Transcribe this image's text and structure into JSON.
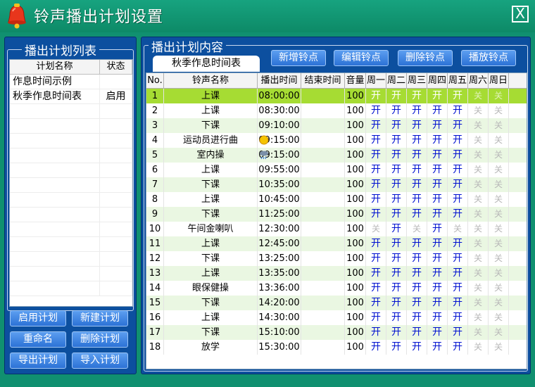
{
  "window": {
    "title": "铃声播出计划设置",
    "close_label": "X"
  },
  "left": {
    "title": "播出计划列表",
    "columns": [
      "计划名称",
      "状态"
    ],
    "plans": [
      {
        "name": "作息时间示例",
        "state": ""
      },
      {
        "name": "秋季作息时间表",
        "state": "启用"
      }
    ],
    "buttons": [
      "启用计划",
      "新建计划",
      "重命名",
      "删除计划",
      "导出计划",
      "导入计划"
    ]
  },
  "right": {
    "title": "播出计划内容",
    "tab": "秋季作息时间表",
    "buttons": [
      "新增铃点",
      "编辑铃点",
      "删除铃点",
      "播放铃点"
    ],
    "columns": [
      "No.",
      "铃声名称",
      "播出时间",
      "结束时间",
      "音量",
      "周一",
      "周二",
      "周三",
      "周四",
      "周五",
      "周六",
      "周日"
    ],
    "on_label": "开",
    "off_label": "关",
    "rows": [
      {
        "no": "1",
        "name": "上课",
        "start": "08:00:00",
        "end": "",
        "vol": "100",
        "days": [
          1,
          1,
          1,
          1,
          1,
          0,
          0
        ],
        "weather": ""
      },
      {
        "no": "2",
        "name": "上课",
        "start": "08:30:00",
        "end": "",
        "vol": "100",
        "days": [
          1,
          1,
          1,
          1,
          1,
          0,
          0
        ],
        "weather": ""
      },
      {
        "no": "3",
        "name": "下课",
        "start": "09:10:00",
        "end": "",
        "vol": "100",
        "days": [
          1,
          1,
          1,
          1,
          1,
          0,
          0
        ],
        "weather": ""
      },
      {
        "no": "4",
        "name": "运动员进行曲",
        "start": "09:15:00",
        "end": "",
        "vol": "100",
        "days": [
          1,
          1,
          1,
          1,
          1,
          0,
          0
        ],
        "weather": "sunny-icon"
      },
      {
        "no": "5",
        "name": "室内操",
        "start": "09:15:00",
        "end": "",
        "vol": "100",
        "days": [
          1,
          1,
          1,
          1,
          1,
          0,
          0
        ],
        "weather": "rain-cloud-icon"
      },
      {
        "no": "6",
        "name": "上课",
        "start": "09:55:00",
        "end": "",
        "vol": "100",
        "days": [
          1,
          1,
          1,
          1,
          1,
          0,
          0
        ],
        "weather": ""
      },
      {
        "no": "7",
        "name": "下课",
        "start": "10:35:00",
        "end": "",
        "vol": "100",
        "days": [
          1,
          1,
          1,
          1,
          1,
          0,
          0
        ],
        "weather": ""
      },
      {
        "no": "8",
        "name": "上课",
        "start": "10:45:00",
        "end": "",
        "vol": "100",
        "days": [
          1,
          1,
          1,
          1,
          1,
          0,
          0
        ],
        "weather": ""
      },
      {
        "no": "9",
        "name": "下课",
        "start": "11:25:00",
        "end": "",
        "vol": "100",
        "days": [
          1,
          1,
          1,
          1,
          1,
          0,
          0
        ],
        "weather": ""
      },
      {
        "no": "10",
        "name": "午间金喇叭",
        "start": "12:30:00",
        "end": "",
        "vol": "100",
        "days": [
          0,
          1,
          0,
          1,
          0,
          0,
          0
        ],
        "weather": ""
      },
      {
        "no": "11",
        "name": "上课",
        "start": "12:45:00",
        "end": "",
        "vol": "100",
        "days": [
          1,
          1,
          1,
          1,
          1,
          0,
          0
        ],
        "weather": ""
      },
      {
        "no": "12",
        "name": "下课",
        "start": "13:25:00",
        "end": "",
        "vol": "100",
        "days": [
          1,
          1,
          1,
          1,
          1,
          0,
          0
        ],
        "weather": ""
      },
      {
        "no": "13",
        "name": "上课",
        "start": "13:35:00",
        "end": "",
        "vol": "100",
        "days": [
          1,
          1,
          1,
          1,
          1,
          0,
          0
        ],
        "weather": ""
      },
      {
        "no": "14",
        "name": "眼保健操",
        "start": "13:36:00",
        "end": "",
        "vol": "100",
        "days": [
          1,
          1,
          1,
          1,
          1,
          0,
          0
        ],
        "weather": ""
      },
      {
        "no": "15",
        "name": "下课",
        "start": "14:20:00",
        "end": "",
        "vol": "100",
        "days": [
          1,
          1,
          1,
          1,
          1,
          0,
          0
        ],
        "weather": ""
      },
      {
        "no": "16",
        "name": "上课",
        "start": "14:30:00",
        "end": "",
        "vol": "100",
        "days": [
          1,
          1,
          1,
          1,
          1,
          0,
          0
        ],
        "weather": ""
      },
      {
        "no": "17",
        "name": "下课",
        "start": "15:10:00",
        "end": "",
        "vol": "100",
        "days": [
          1,
          1,
          1,
          1,
          1,
          0,
          0
        ],
        "weather": ""
      },
      {
        "no": "18",
        "name": "放学",
        "start": "15:30:00",
        "end": "",
        "vol": "100",
        "days": [
          1,
          1,
          1,
          1,
          1,
          0,
          0
        ],
        "weather": ""
      }
    ]
  },
  "colors": {
    "window_bg": "#109070",
    "panel_bg": "#0c4f9f",
    "selected_row": "#a6dc33",
    "stripe_row": "#eaf7e2",
    "on_text": "#0010d0"
  }
}
